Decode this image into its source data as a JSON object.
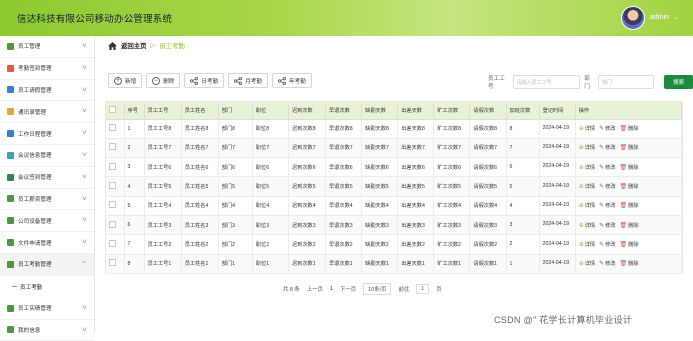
{
  "header": {
    "title": "信达科技有限公司移动办公管理系统",
    "username": "admin"
  },
  "sidebar": {
    "items": [
      {
        "label": "员工管理",
        "color": "#4a9a3c"
      },
      {
        "label": "考勤签到管理",
        "color": "#e05a3a"
      },
      {
        "label": "员工请假管理",
        "color": "#3a7bd5"
      },
      {
        "label": "通讯录管理",
        "color": "#e0a83a"
      },
      {
        "label": "工作日程管理",
        "color": "#3a7bd5"
      },
      {
        "label": "会议信息管理",
        "color": "#3aa0c0"
      },
      {
        "label": "会议签到管理",
        "color": "#2d8a4a"
      },
      {
        "label": "员工薪资管理",
        "color": "#4a9a3c"
      },
      {
        "label": "公司设备管理",
        "color": "#4a9a3c"
      },
      {
        "label": "文件申请管理",
        "color": "#4a9a3c"
      },
      {
        "label": "员工考勤管理",
        "color": "#4a9a3c",
        "active": true
      }
    ],
    "sub_item": "员工考勤",
    "items_after": [
      {
        "label": "员工实绩管理",
        "color": "#4a9a3c"
      },
      {
        "label": "我的信息",
        "color": "#4a9a3c"
      }
    ]
  },
  "breadcrumb": {
    "home": "返回主页",
    "separator": "▷",
    "current": "员工考勤"
  },
  "toolbar": {
    "add": "新增",
    "delete": "删除",
    "daily": "日考勤",
    "monthly": "月考勤",
    "yearly": "年考勤"
  },
  "search": {
    "emp_label": "员工工号",
    "emp_placeholder": "请输入员工工号",
    "dept_label": "部门",
    "dept_placeholder": "部门",
    "button": "搜索"
  },
  "table": {
    "columns": [
      "",
      "序号",
      "员工工号",
      "员工姓名",
      "部门",
      "职位",
      "迟到次数",
      "早退次数",
      "缺勤天数",
      "出差天数",
      "旷工次数",
      "请假次数",
      "加班次数",
      "登记时间",
      "操作"
    ],
    "rows": [
      [
        "1",
        "员工工号8",
        "员工姓名8",
        "部门8",
        "职位8",
        "迟到次数8",
        "早退次数8",
        "缺勤天数8",
        "出差天数8",
        "旷工次数8",
        "请假次数8",
        "8",
        "2024-04-19"
      ],
      [
        "2",
        "员工工号7",
        "员工姓名7",
        "部门7",
        "职位7",
        "迟到次数7",
        "早退次数7",
        "缺勤天数7",
        "出差天数7",
        "旷工次数7",
        "请假次数7",
        "7",
        "2024-04-19"
      ],
      [
        "3",
        "员工工号6",
        "员工姓名6",
        "部门6",
        "职位6",
        "迟到次数6",
        "早退次数6",
        "缺勤天数6",
        "出差天数6",
        "旷工次数6",
        "请假次数6",
        "6",
        "2024-04-19"
      ],
      [
        "4",
        "员工工号5",
        "员工姓名5",
        "部门5",
        "职位5",
        "迟到次数5",
        "早退次数5",
        "缺勤天数5",
        "出差天数5",
        "旷工次数5",
        "请假次数5",
        "5",
        "2024-04-19"
      ],
      [
        "5",
        "员工工号4",
        "员工姓名4",
        "部门4",
        "职位4",
        "迟到次数4",
        "早退次数4",
        "缺勤天数4",
        "出差天数4",
        "旷工次数4",
        "请假次数4",
        "4",
        "2024-04-19"
      ],
      [
        "6",
        "员工工号3",
        "员工姓名3",
        "部门3",
        "职位3",
        "迟到次数3",
        "早退次数3",
        "缺勤天数3",
        "出差天数3",
        "旷工次数3",
        "请假次数3",
        "3",
        "2024-04-19"
      ],
      [
        "7",
        "员工工号2",
        "员工姓名2",
        "部门2",
        "职位2",
        "迟到次数2",
        "早退次数2",
        "缺勤天数2",
        "出差天数2",
        "旷工次数2",
        "请假次数2",
        "2",
        "2024-04-19"
      ],
      [
        "8",
        "员工工号1",
        "员工姓名1",
        "部门1",
        "职位1",
        "迟到次数1",
        "早退次数1",
        "缺勤天数1",
        "出差天数1",
        "旷工次数1",
        "请假次数1",
        "1",
        "2024-04-19"
      ]
    ],
    "actions": {
      "view": "详情",
      "edit": "修改",
      "delete": "删除"
    }
  },
  "pager": {
    "total": "共 8 条",
    "prev": "上一页",
    "page": "1",
    "next": "下一页",
    "per_page": "10条/页",
    "goto": "前往",
    "goto_page": "1",
    "page_unit": "页"
  },
  "watermark": "CSDN @\" 花学长计算机毕业设计"
}
